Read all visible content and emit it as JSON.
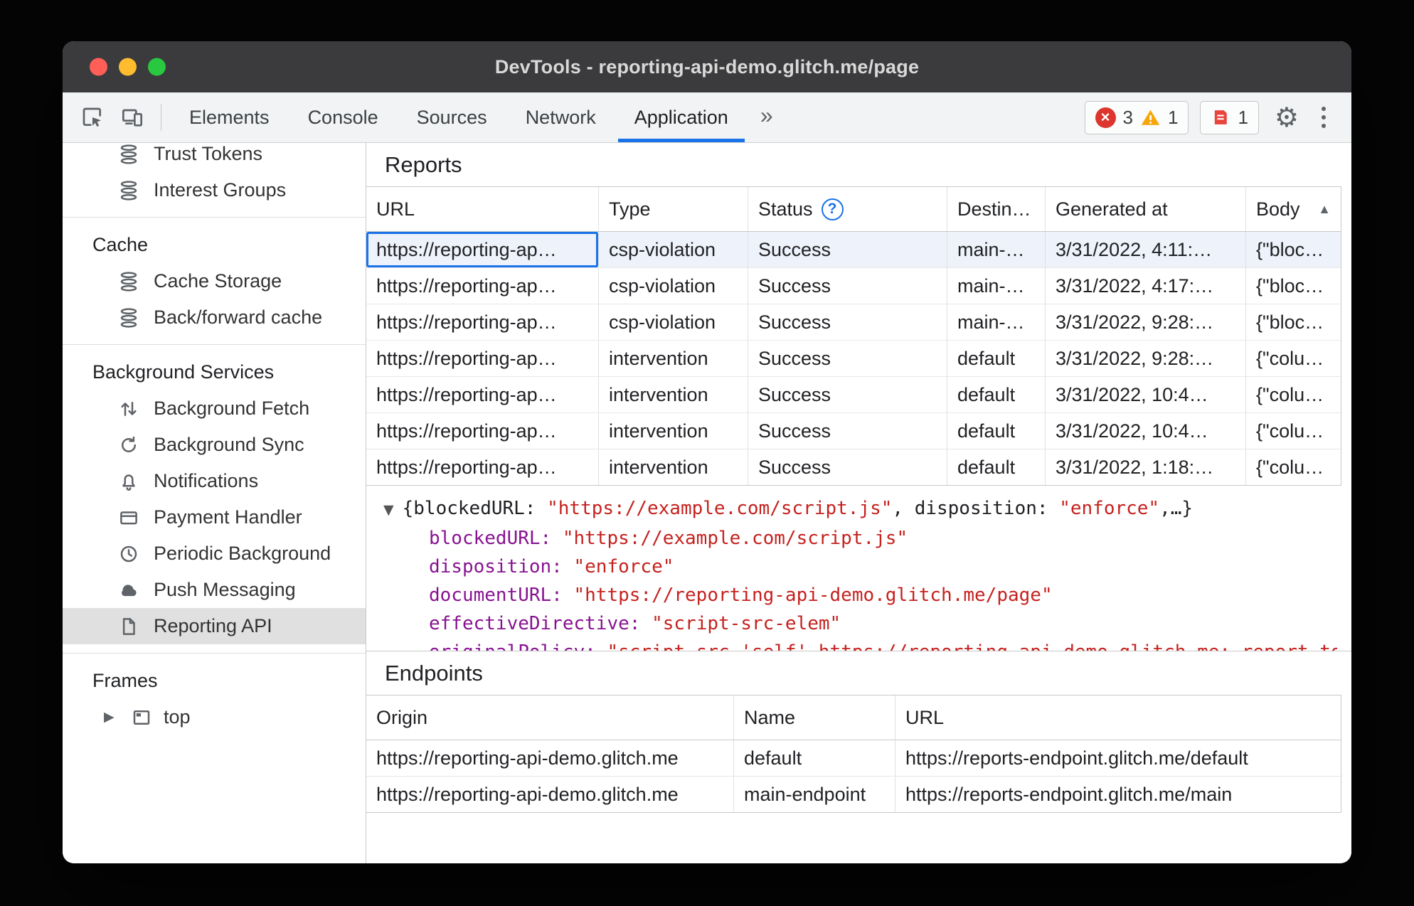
{
  "window": {
    "title": "DevTools - reporting-api-demo.glitch.me/page"
  },
  "toolbar": {
    "tabs": {
      "elements": "Elements",
      "console": "Console",
      "sources": "Sources",
      "network": "Network",
      "application": "Application"
    },
    "more_tabs": "»",
    "badges": {
      "errors": "3",
      "warnings": "1",
      "issues": "1"
    }
  },
  "sidebar": {
    "trust_tokens": "Trust Tokens",
    "interest_groups": "Interest Groups",
    "cache_header": "Cache",
    "cache_storage": "Cache Storage",
    "back_forward_cache": "Back/forward cache",
    "background_header": "Background Services",
    "background_fetch": "Background Fetch",
    "background_sync": "Background Sync",
    "notifications": "Notifications",
    "payment_handler": "Payment Handler",
    "periodic_background": "Periodic Background",
    "push_messaging": "Push Messaging",
    "reporting_api": "Reporting API",
    "frames_header": "Frames",
    "top_frame": "top",
    "expander": "▶"
  },
  "reports": {
    "title": "Reports",
    "columns": {
      "url": "URL",
      "type": "Type",
      "status": "Status",
      "status_help": "?",
      "destination": "Destin…",
      "generated_at": "Generated at",
      "body": "Body",
      "sort_indicator": "▲"
    },
    "rows": [
      {
        "url": "https://reporting-ap…",
        "type": "csp-violation",
        "status": "Success",
        "destination": "main-…",
        "generated_at": "3/31/2022, 4:11:…",
        "body": "{\"bloc…"
      },
      {
        "url": "https://reporting-ap…",
        "type": "csp-violation",
        "status": "Success",
        "destination": "main-…",
        "generated_at": "3/31/2022, 4:17:…",
        "body": "{\"bloc…"
      },
      {
        "url": "https://reporting-ap…",
        "type": "csp-violation",
        "status": "Success",
        "destination": "main-…",
        "generated_at": "3/31/2022, 9:28:…",
        "body": "{\"bloc…"
      },
      {
        "url": "https://reporting-ap…",
        "type": "intervention",
        "status": "Success",
        "destination": "default",
        "generated_at": "3/31/2022, 9:28:…",
        "body": "{\"colu…"
      },
      {
        "url": "https://reporting-ap…",
        "type": "intervention",
        "status": "Success",
        "destination": "default",
        "generated_at": "3/31/2022, 10:4…",
        "body": "{\"colu…"
      },
      {
        "url": "https://reporting-ap…",
        "type": "intervention",
        "status": "Success",
        "destination": "default",
        "generated_at": "3/31/2022, 10:4…",
        "body": "{\"colu…"
      },
      {
        "url": "https://reporting-ap…",
        "type": "intervention",
        "status": "Success",
        "destination": "default",
        "generated_at": "3/31/2022, 1:18:…",
        "body": "{\"colu…"
      }
    ]
  },
  "detail": {
    "caret": "▼",
    "preview": {
      "p1": "{blockedURL: ",
      "v1": "\"https://example.com/script.js\"",
      "p2": ", disposition: ",
      "v2": "\"enforce\"",
      "p3": ",…}"
    },
    "props": [
      {
        "key": "blockedURL:",
        "value": "\"https://example.com/script.js\""
      },
      {
        "key": "disposition:",
        "value": "\"enforce\""
      },
      {
        "key": "documentURL:",
        "value": "\"https://reporting-api-demo.glitch.me/page\""
      },
      {
        "key": "effectiveDirective:",
        "value": "\"script-src-elem\""
      },
      {
        "key": "originalPolicy:",
        "value": "\"script-src 'self' https://reporting-api-demo.glitch.me; report-to main-endpoint\""
      }
    ]
  },
  "endpoints": {
    "title": "Endpoints",
    "columns": {
      "origin": "Origin",
      "name": "Name",
      "url": "URL"
    },
    "rows": [
      {
        "origin": "https://reporting-api-demo.glitch.me",
        "name": "default",
        "url": "https://reports-endpoint.glitch.me/default"
      },
      {
        "origin": "https://reporting-api-demo.glitch.me",
        "name": "main-endpoint",
        "url": "https://reports-endpoint.glitch.me/main"
      }
    ]
  },
  "colors": {
    "accent": "#1a73e8",
    "error": "#dc362e",
    "warning": "#f6a609",
    "json_key": "#881391",
    "json_string": "#c5221f",
    "selected_row": "#eef2fa",
    "sidebar_selected": "#e0e0e0"
  }
}
